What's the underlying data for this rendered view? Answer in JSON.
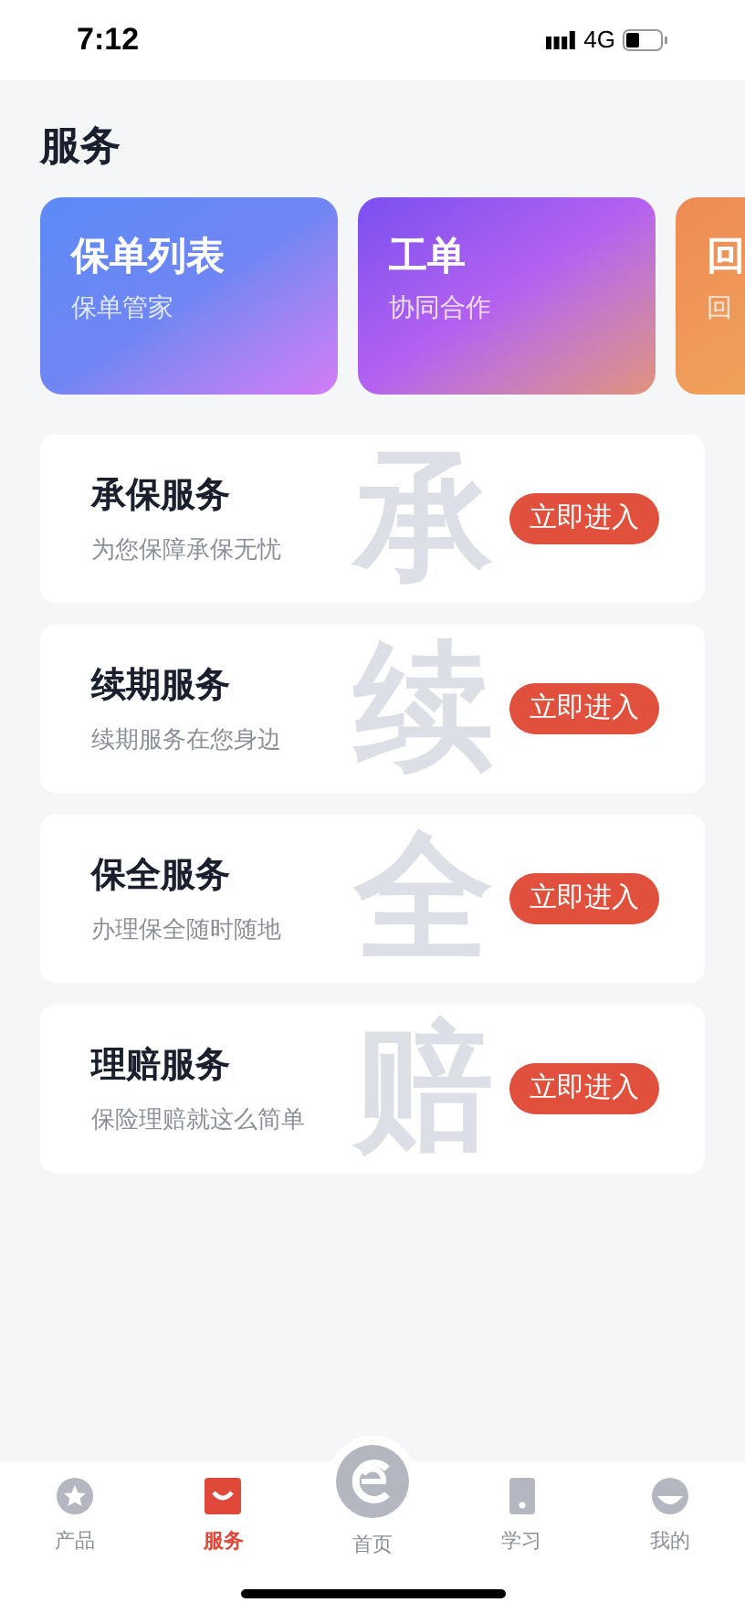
{
  "status_bar": {
    "time": "7:12",
    "network": "4G"
  },
  "page_title": "服务",
  "feature_cards": [
    {
      "title": "保单列表",
      "subtitle": "保单管家",
      "kind": "blue"
    },
    {
      "title": "工单",
      "subtitle": "协同合作",
      "kind": "purple"
    },
    {
      "title": "回",
      "subtitle": "回",
      "kind": "orange"
    }
  ],
  "services": [
    {
      "title": "承保服务",
      "subtitle": "为您保障承保无忧",
      "backdrop": "承",
      "button": "立即进入"
    },
    {
      "title": "续期服务",
      "subtitle": "续期服务在您身边",
      "backdrop": "续",
      "button": "立即进入"
    },
    {
      "title": "保全服务",
      "subtitle": "办理保全随时随地",
      "backdrop": "全",
      "button": "立即进入"
    },
    {
      "title": "理赔服务",
      "subtitle": "保险理赔就这么简单",
      "backdrop": "赔",
      "button": "立即进入"
    }
  ],
  "tab_bar": [
    {
      "label": "产品",
      "kind": "star",
      "selected": false
    },
    {
      "label": "服务",
      "kind": "bag",
      "selected": true
    },
    {
      "label": "首页",
      "kind": "home",
      "selected": false
    },
    {
      "label": "学习",
      "kind": "phone",
      "selected": false
    },
    {
      "label": "我的",
      "kind": "face",
      "selected": false
    }
  ]
}
